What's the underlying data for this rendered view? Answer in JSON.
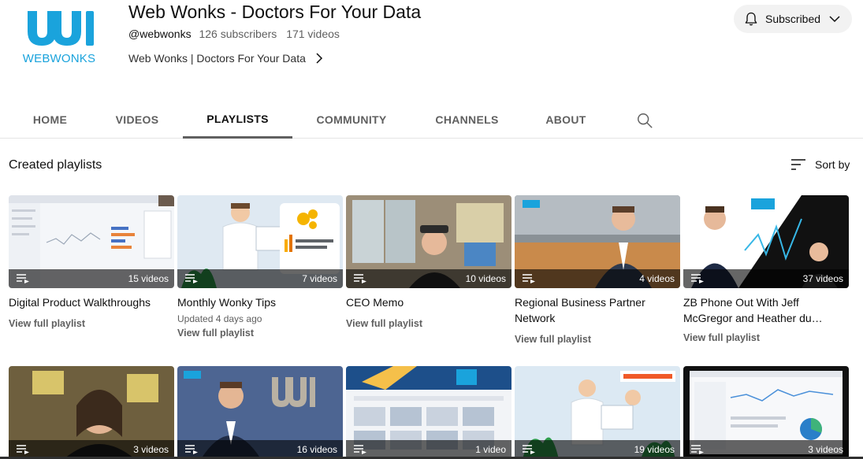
{
  "channel": {
    "logo_text": "WEBWONKS",
    "title": "Web Wonks - Doctors For Your Data",
    "handle": "@webwonks",
    "subscribers": "126 subscribers",
    "videos": "171 videos",
    "link_text": "Web Wonks | Doctors For Your Data",
    "brand_color": "#1aa3dc"
  },
  "subscribe": {
    "label": "Subscribed",
    "icon": "bell-icon"
  },
  "tabs": [
    {
      "label": "HOME"
    },
    {
      "label": "VIDEOS"
    },
    {
      "label": "PLAYLISTS",
      "active": true
    },
    {
      "label": "COMMUNITY"
    },
    {
      "label": "CHANNELS"
    },
    {
      "label": "ABOUT"
    }
  ],
  "section": {
    "title": "Created playlists",
    "sort_label": "Sort by"
  },
  "playlists": [
    {
      "title": "Digital Product Walkthroughs",
      "count": "15 videos",
      "link": "View full playlist"
    },
    {
      "title": "Monthly Wonky Tips",
      "count": "7 videos",
      "updated": "Updated 4 days ago",
      "link": "View full playlist"
    },
    {
      "title": "CEO Memo",
      "count": "10 videos",
      "link": "View full playlist"
    },
    {
      "title": "Regional Business Partner Network",
      "count": "4 videos",
      "link": "View full playlist"
    },
    {
      "title": "ZB Phone Out With Jeff McGregor and Heather du…",
      "count": "37 videos",
      "link": "View full playlist"
    },
    {
      "count": "3 videos"
    },
    {
      "count": "16 videos"
    },
    {
      "count": "1 video"
    },
    {
      "count": "19 videos"
    },
    {
      "count": "3 videos"
    }
  ]
}
